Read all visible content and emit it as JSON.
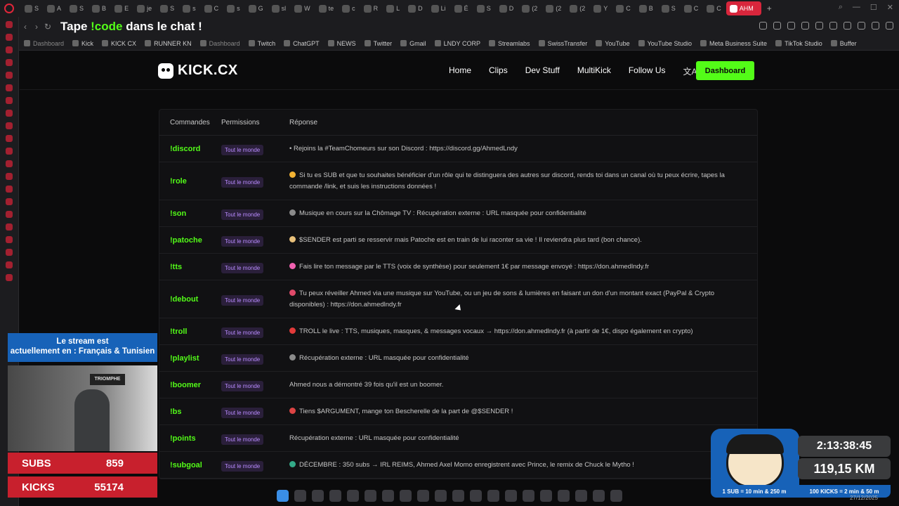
{
  "browser": {
    "tabs": [
      "S",
      "A",
      "S",
      "B",
      "E",
      "je",
      "S",
      "s",
      "C",
      "s",
      "G",
      "sl",
      "W",
      "te",
      "c",
      "R",
      "L",
      "D",
      "Li",
      "É",
      "S",
      "D",
      "(2",
      "(2",
      "(2",
      "Y",
      "C",
      "B",
      "S",
      "C",
      "C"
    ],
    "active_tab": "AHM",
    "page_title_pre": "Tape ",
    "page_title_code": "!code",
    "page_title_post": " dans le chat !"
  },
  "bookmarks": [
    "Dashboard",
    "Kick",
    "KICK CX",
    "RUNNER KN",
    "Dashboard",
    "Twitch",
    "ChatGPT",
    "NEWS",
    "Twitter",
    "Gmail",
    "LNDY CORP",
    "Streamlabs",
    "SwissTransfer",
    "YouTube",
    "YouTube Studio",
    "Meta Business Suite",
    "TikTok Studio",
    "Buffer"
  ],
  "site": {
    "brand": "KICK.CX",
    "nav": [
      "Home",
      "Clips",
      "Dev Stuff",
      "MultiKick",
      "Follow Us"
    ],
    "dashboard_label": "Dashboard",
    "accent": "#53fc18"
  },
  "table": {
    "headers": [
      "Commandes",
      "Permissions",
      "Réponse"
    ],
    "rows": [
      {
        "cmd": "!discord",
        "perm": "Tout le monde",
        "resp": "• Rejoins la #TeamChomeurs sur son Discord : https://discord.gg/AhmedLndy"
      },
      {
        "cmd": "!role",
        "perm": "Tout le monde",
        "resp": "Si tu es SUB et que tu souhaites bénéficier d'un rôle qui te distinguera des autres sur discord, rends toi dans un canal où tu peux écrire, tapes la commande /link, et suis les instructions données !"
      },
      {
        "cmd": "!son",
        "perm": "Tout le monde",
        "resp": "Musique en cours sur la Chômage TV : Récupération externe : URL masquée pour confidentialité"
      },
      {
        "cmd": "!patoche",
        "perm": "Tout le monde",
        "resp": "$SENDER est parti se resservir mais Patoche est en train de lui raconter sa vie ! Il reviendra plus tard (bon chance)."
      },
      {
        "cmd": "!tts",
        "perm": "Tout le monde",
        "resp": "Fais lire ton message par le TTS (voix de synthèse) pour seulement 1€ par message envoyé : https://don.ahmedlndy.fr"
      },
      {
        "cmd": "!debout",
        "perm": "Tout le monde",
        "resp": "Tu peux réveiller Ahmed via une musique sur YouTube, ou un jeu de sons & lumières en faisant un don d'un montant exact (PayPal & Crypto disponibles) : https://don.ahmedlndy.fr"
      },
      {
        "cmd": "!troll",
        "perm": "Tout le monde",
        "resp": "TROLL le live : TTS, musiques, masques, & messages vocaux → https://don.ahmedlndy.fr (à partir de 1€, dispo également en crypto)"
      },
      {
        "cmd": "!playlist",
        "perm": "Tout le monde",
        "resp": "Récupération externe : URL masquée pour confidentialité"
      },
      {
        "cmd": "!boomer",
        "perm": "Tout le monde",
        "resp": "Ahmed nous a démontré 39 fois qu'il est un boomer."
      },
      {
        "cmd": "!bs",
        "perm": "Tout le monde",
        "resp": "Tiens $ARGUMENT, mange ton Bescherelle de la part de @$SENDER !"
      },
      {
        "cmd": "!points",
        "perm": "Tout le monde",
        "resp": "Récupération externe : URL masquée pour confidentialité"
      },
      {
        "cmd": "!subgoal",
        "perm": "Tout le monde",
        "resp": "DÉCEMBRE : 350 subs → IRL REIMS, Ahmed Axel Momo enregistrent avec Prince, le remix de Chuck le Mytho !"
      }
    ]
  },
  "overlay": {
    "lang_line1": "Le stream est",
    "lang_line2": "actuellement en : Français & Tunisien",
    "poster": "TRIOMPHE",
    "subs_label": "SUBS",
    "subs_value": "859",
    "kicks_label": "KICKS",
    "kicks_value": "55174",
    "timer": "2:13:38:45",
    "distance": "119,15 KM",
    "rule1": "1 SUB = 10 min & 250 m",
    "rule2": "100 KICKS = 2 min & 50 m"
  },
  "tray": {
    "date": "27/12/2025"
  }
}
